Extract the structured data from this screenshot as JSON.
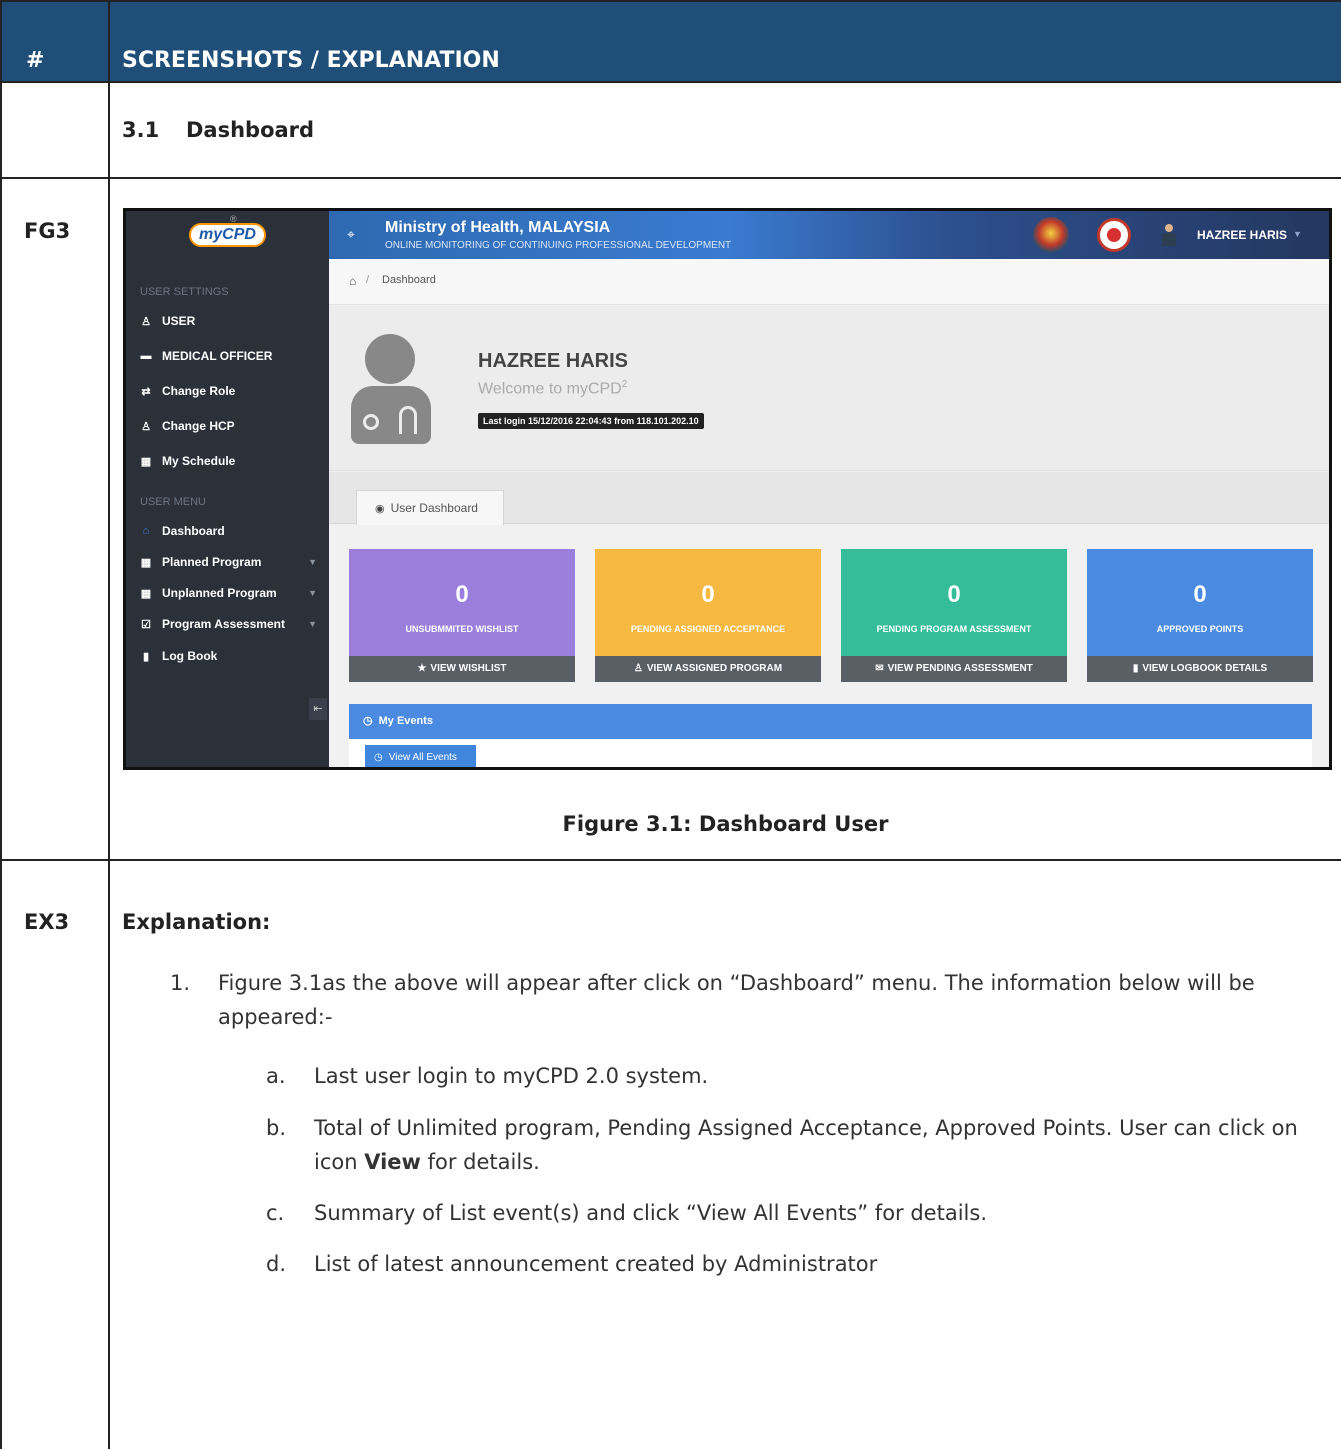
{
  "header": {
    "col1": "#",
    "col2": "SCREENSHOTS / EXPLANATION"
  },
  "section": {
    "number": "3.1",
    "title": "Dashboard"
  },
  "rows": {
    "fg": "FG3",
    "ex": "EX3"
  },
  "figure_caption": "Figure 3.1: Dashboard User",
  "screenshot": {
    "logo": "myCPD",
    "logo_mark": "®",
    "topbar": {
      "title": "Ministry of Health, MALAYSIA",
      "subtitle": "ONLINE MONITORING OF CONTINUING PROFESSIONAL DEVELOPMENT",
      "user": "HAZREE HARIS"
    },
    "sidebar": {
      "settings_label": "USER SETTINGS",
      "settings_items": [
        {
          "label": "USER",
          "icon": "user-icon"
        },
        {
          "label": "MEDICAL OFFICER",
          "icon": "minus-icon"
        },
        {
          "label": "Change Role",
          "icon": "retweet-icon"
        },
        {
          "label": "Change HCP",
          "icon": "user-md-icon"
        },
        {
          "label": "My Schedule",
          "icon": "calendar-icon"
        }
      ],
      "menu_label": "USER MENU",
      "menu_items": [
        {
          "label": "Dashboard",
          "icon": "home-icon"
        },
        {
          "label": "Planned Program",
          "icon": "calendar-icon"
        },
        {
          "label": "Unplanned Program",
          "icon": "calendar-icon"
        },
        {
          "label": "Program Assessment",
          "icon": "check-square-icon"
        },
        {
          "label": "Log Book",
          "icon": "book-icon"
        }
      ]
    },
    "breadcrumb": {
      "current": "Dashboard"
    },
    "profile": {
      "name": "HAZREE HARIS",
      "welcome": "Welcome to myCPD",
      "welcome_sup": "2",
      "last_login": "Last login 15/12/2016 22:04:43 from 118.101.202.10"
    },
    "tab": {
      "label": "User Dashboard"
    },
    "cards": [
      {
        "value": "0",
        "label": "UNSUBMMITED WISHLIST",
        "action": "VIEW WISHLIST",
        "color": "#9b7fdc"
      },
      {
        "value": "0",
        "label": "PENDING ASSIGNED ACCEPTANCE",
        "action": "VIEW ASSIGNED PROGRAM",
        "color": "#f5b942"
      },
      {
        "value": "0",
        "label": "PENDING PROGRAM ASSESSMENT",
        "action": "VIEW PENDING ASSESSMENT",
        "color": "#35bd9a"
      },
      {
        "value": "0",
        "label": "APPROVED POINTS",
        "action": "VIEW LOGBOOK DETAILS",
        "color": "#4a8ae0"
      }
    ],
    "events": {
      "title": "My Events",
      "button": "View All Events"
    }
  },
  "explanation": {
    "heading": "Explanation:",
    "item1": "Figure 3.1as the above will appear after click on “Dashboard” menu. The information below will be appeared:-",
    "sub_a": "Last user login to myCPD 2.0 system.",
    "sub_b_pre": "Total of Unlimited program, Pending Assigned Acceptance, Approved Points. User can click on icon ",
    "sub_b_bold": "View",
    "sub_b_post": " for details.",
    "sub_c": "Summary of List event(s) and click “View All Events” for details.",
    "sub_d": "List of latest announcement created by Administrator"
  }
}
